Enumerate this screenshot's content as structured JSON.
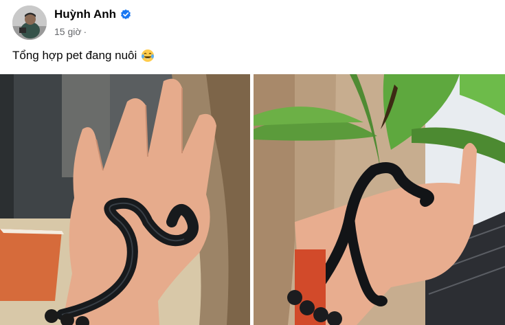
{
  "post": {
    "author": "Huỳnh Anh",
    "time": "15 giờ",
    "separator": "·",
    "text": "Tổng hợp pet đang nuôi",
    "emoji": "laughing-tears-emoji"
  },
  "icons": {
    "verified": "verified-badge-icon",
    "privacy": "globe-icon"
  },
  "colors": {
    "verified_blue": "#1877f2",
    "name_text": "#050505",
    "meta_text": "#65676b"
  },
  "photos": [
    {
      "subject": "black snake coiled on open palm"
    },
    {
      "subject": "black snake wrapped around wrist near plant"
    }
  ]
}
